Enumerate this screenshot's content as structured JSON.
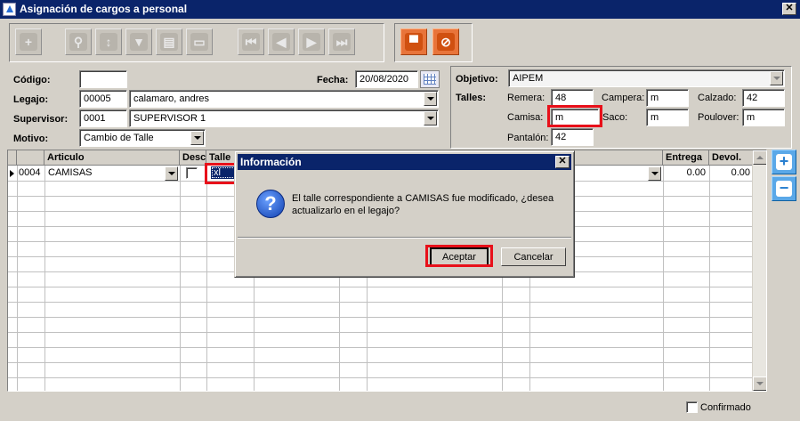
{
  "window": {
    "title": "Asignación de cargos a personal"
  },
  "toolbar": {
    "buttons": [
      "add",
      "search",
      "sort",
      "filter",
      "print-preview",
      "print",
      "first",
      "previous",
      "next",
      "last"
    ],
    "save_glyph": "▀",
    "cancel_glyph": "⊘"
  },
  "form": {
    "codigo": {
      "label": "Código:",
      "value": ""
    },
    "fecha": {
      "label": "Fecha:",
      "value": "20/08/2020"
    },
    "legajo": {
      "label": "Legajo:",
      "code": "00005",
      "name": "calamaro, andres"
    },
    "supervisor": {
      "label": "Supervisor:",
      "code": "0001",
      "name": "SUPERVISOR 1"
    },
    "motivo": {
      "label": "Motivo:",
      "value": "Cambio de Talle"
    }
  },
  "sizes": {
    "objetivo_label": "Objetivo:",
    "objetivo_value": "AIPEM",
    "talles_label": "Talles:",
    "remera": {
      "label": "Remera:",
      "value": "48"
    },
    "campera": {
      "label": "Campera:",
      "value": "m"
    },
    "calzado": {
      "label": "Calzado:",
      "value": "42"
    },
    "camisa": {
      "label": "Camisa:",
      "value": "m"
    },
    "saco": {
      "label": "Saco:",
      "value": "m"
    },
    "poulover": {
      "label": "Poulover:",
      "value": "m"
    },
    "pantalon": {
      "label": "Pantalón:",
      "value": "42"
    }
  },
  "grid": {
    "headers": {
      "articulo": "Articulo",
      "desc": "Desc.",
      "talle": "Talle",
      "entrega": "Entrega",
      "devol": "Devol."
    },
    "row": {
      "code": "0004",
      "articulo": "CAMISAS",
      "talle": "xl",
      "entrega": "0.00",
      "devol": "0.00"
    }
  },
  "footer": {
    "confirmado_label": "Confirmado"
  },
  "dialog": {
    "title": "Información",
    "message": "El talle correspondiente a CAMISAS fue modificado, ¿desea actualizarlo en el legajo?",
    "ok_label": "Aceptar",
    "cancel_label": "Cancelar",
    "icon_glyph": "?"
  },
  "colors": {
    "highlight": "#e8101a",
    "title_bar": "#0a246a"
  }
}
